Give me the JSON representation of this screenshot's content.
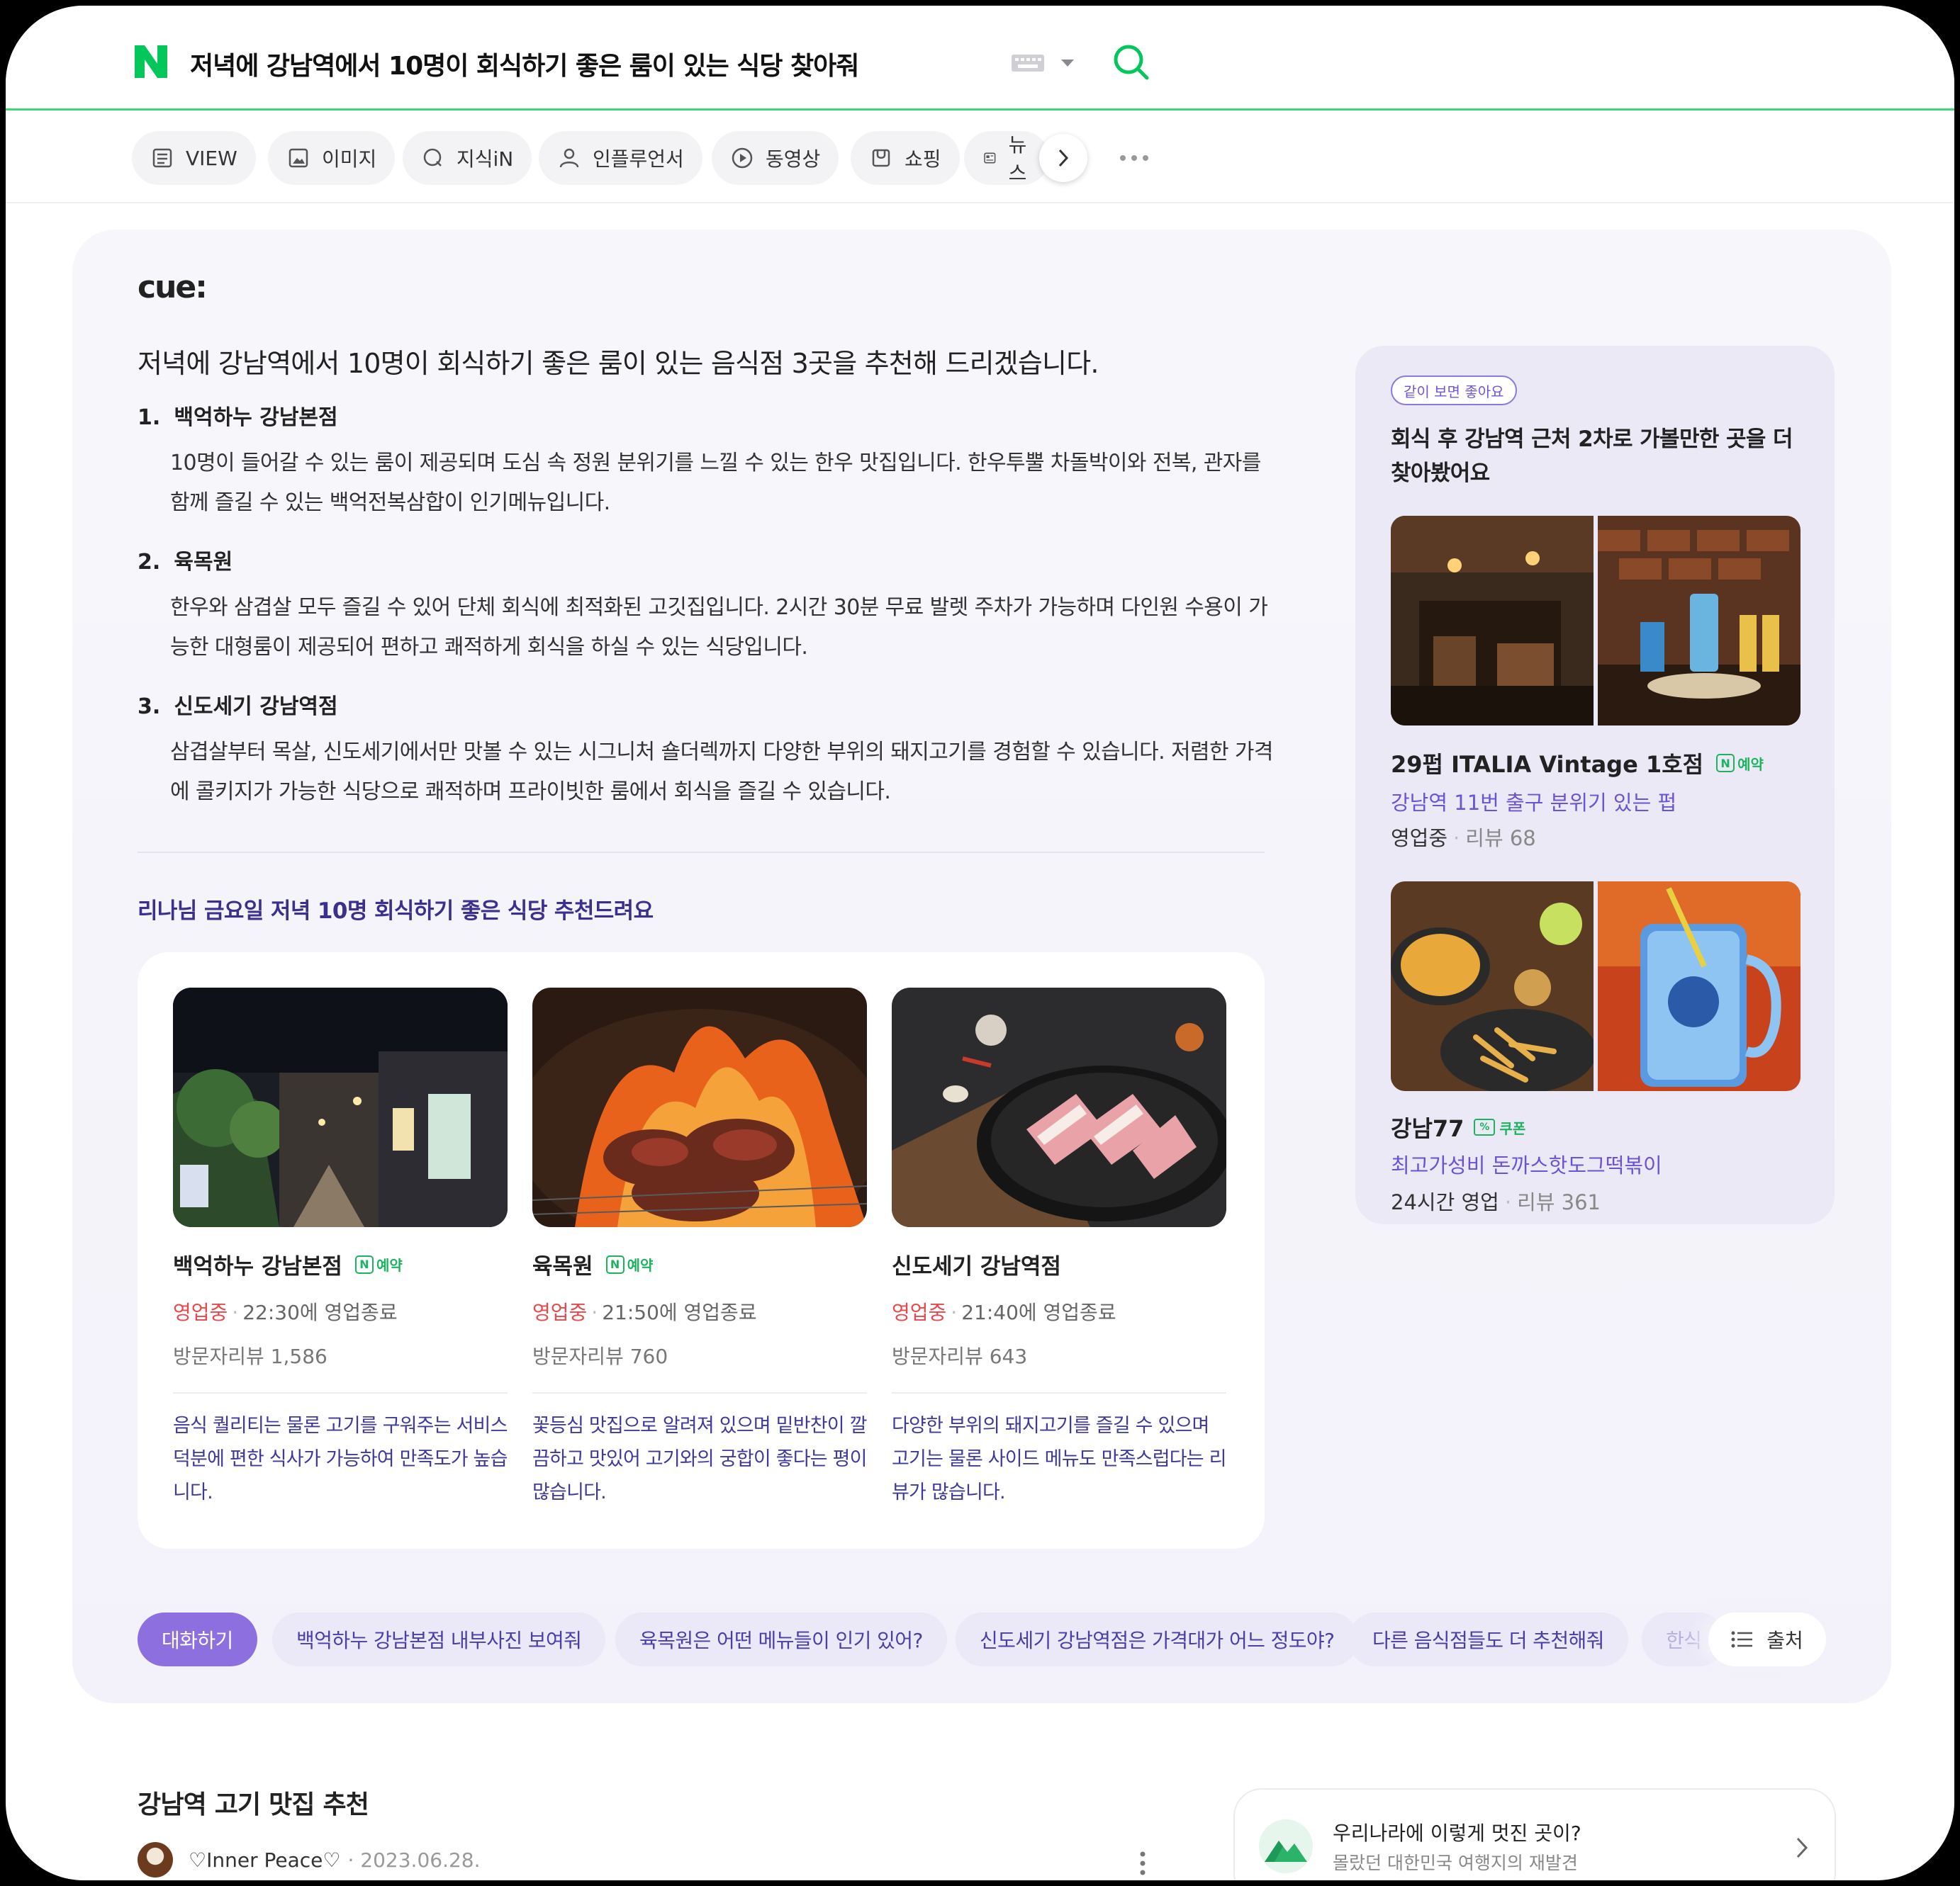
{
  "search": {
    "query": "저녁에 강남역에서 10명이 회식하기 좋은 룸이 있는 식당 찾아줘"
  },
  "tabs": [
    {
      "label": "VIEW",
      "icon": "view-icon"
    },
    {
      "label": "이미지",
      "icon": "image-icon"
    },
    {
      "label": "지식iN",
      "icon": "kin-icon"
    },
    {
      "label": "인플루언서",
      "icon": "person-icon"
    },
    {
      "label": "동영상",
      "icon": "play-icon"
    },
    {
      "label": "쇼핑",
      "icon": "bag-icon"
    },
    {
      "label": "뉴스",
      "icon": "news-icon"
    }
  ],
  "cue": {
    "logo": "cue:",
    "answer_title": "저녁에 강남역에서 10명이 회식하기 좋은 룸이 있는 음식점 3곳을 추천해 드리겠습니다.",
    "recommendations": [
      {
        "num": "1.",
        "name": "백억하누 강남본점",
        "desc": "10명이 들어갈 수 있는 룸이 제공되며 도심 속 정원 분위기를 느낄 수 있는 한우 맛집입니다. 한우투뿔 차돌박이와 전복, 관자를 함께 즐길 수 있는 백억전복삼합이 인기메뉴입니다."
      },
      {
        "num": "2.",
        "name": "육목원",
        "desc": "한우와 삼겹살 모두 즐길 수 있어 단체 회식에 최적화된 고깃집입니다. 2시간 30분 무료 발렛 주차가 가능하며 다인원 수용이 가능한 대형룸이 제공되어 편하고 쾌적하게 회식을 하실 수 있는 식당입니다."
      },
      {
        "num": "3.",
        "name": "신도세기 강남역점",
        "desc": "삼겹살부터 목살, 신도세기에서만 맛볼 수 있는 시그니처 숄더렉까지 다양한 부위의 돼지고기를 경험할 수 있습니다. 저렴한 가격에 콜키지가 가능한 식당으로 쾌적하며 프라이빗한 룸에서 회식을 즐길 수 있습니다."
      }
    ],
    "sub_title": "리나님 금요일 저녁 10명 회식하기 좋은 식당 추천드려요",
    "cards": [
      {
        "name": "백억하누 강남본점",
        "badge": "예약",
        "status": "영업중",
        "hours": "22:30에 영업종료",
        "review": "방문자리뷰 1,586",
        "desc": "음식 퀄리티는 물론 고기를 구워주는 서비스 덕분에 편한 식사가 가능하여 만족도가 높습니다."
      },
      {
        "name": "육목원",
        "badge": "예약",
        "status": "영업중",
        "hours": "21:50에 영업종료",
        "review": "방문자리뷰 760",
        "desc": "꽃등심 맛집으로 알려져 있으며 밑반찬이 깔끔하고 맛있어 고기와의 궁합이 좋다는 평이 많습니다."
      },
      {
        "name": "신도세기 강남역점",
        "badge": "",
        "status": "영업중",
        "hours": "21:40에 영업종료",
        "review": "방문자리뷰 643",
        "desc": "다양한 부위의 돼지고기를 즐길 수 있으며 고기는 물론 사이드 메뉴도 만족스럽다는 리뷰가 많습니다."
      }
    ],
    "side": {
      "pill": "같이 보면 좋아요",
      "title": "회식 후 강남역 근처 2차로 가볼만한 곳을 더 찾아봤어요",
      "places": [
        {
          "name": "29펍 ITALIA Vintage 1호점",
          "badge": "예약",
          "sub": "강남역 11번 출구 분위기 있는 펍",
          "status": "영업중",
          "review": "리뷰 68"
        },
        {
          "name": "강남77",
          "badge": "쿠폰",
          "sub": "최고가성비 돈까스핫도그떡볶이",
          "status": "24시간 영업",
          "review": "리뷰 361"
        }
      ]
    },
    "chips": [
      "대화하기",
      "백억하누 강남본점 내부사진 보여줘",
      "육목원은 어떤 메뉴들이 인기 있어?",
      "신도세기 강남역점은 가격대가 어느 정도야?",
      "다른 음식점들도 더 추천해줘",
      "한식"
    ],
    "source_label": "출처"
  },
  "bottom": {
    "title": "강남역 고기 맛집 추천",
    "author": "♡Inner Peace♡",
    "date": "2023.06.28.",
    "promo_title": "우리나라에 이렇게 멋진 곳이?",
    "promo_sub": "몰랐던 대한민국 여행지의 재발견"
  },
  "colors": {
    "naver_green": "#03c75a",
    "accent_purple": "#8e6fe0",
    "link_purple": "#6a54d6",
    "open_red": "#e8484c"
  }
}
